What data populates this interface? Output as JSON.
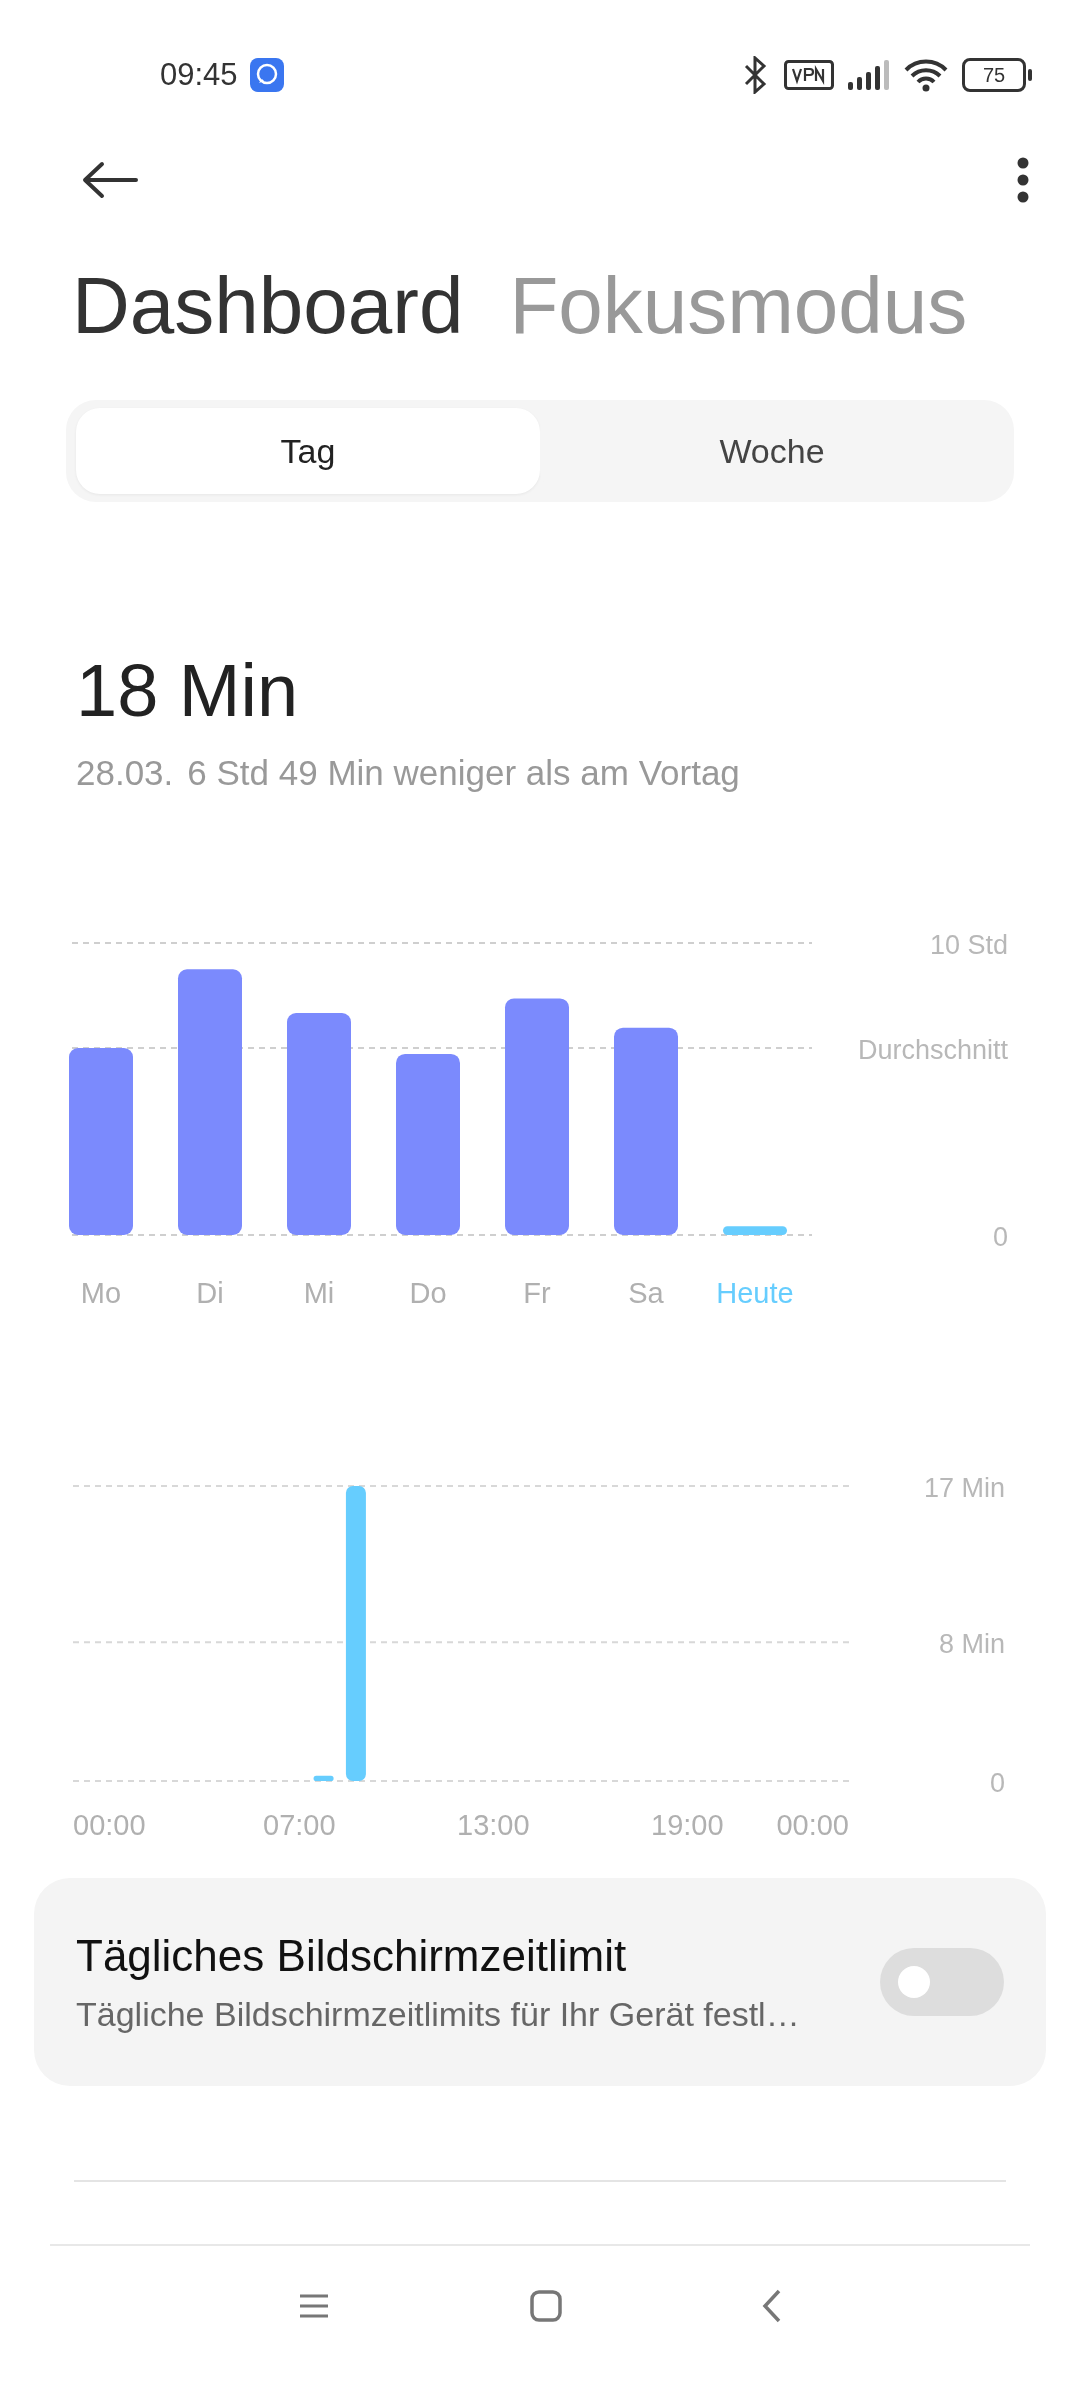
{
  "status_bar": {
    "time": "09:45",
    "battery": "75"
  },
  "title_tabs": [
    {
      "label": "Dashboard",
      "selected": true
    },
    {
      "label": "Fokusmodus",
      "selected": false
    }
  ],
  "segments": [
    {
      "label": "Tag",
      "selected": true
    },
    {
      "label": "Woche",
      "selected": false
    }
  ],
  "summary": {
    "total": "18 Min",
    "date": "28.03.",
    "comparison": "6 Std 49 Min weniger als am Vortag"
  },
  "week_chart": {
    "chart_data": {
      "type": "bar",
      "categories": [
        "Mo",
        "Di",
        "Mi",
        "Do",
        "Fr",
        "Sa",
        "Heute"
      ],
      "ylim": [
        0,
        10
      ],
      "yticks": [
        0,
        {
          "value": 6.4,
          "label": "Durchschnitt"
        },
        {
          "value": 10,
          "label": "10 Std"
        }
      ],
      "series": [
        {
          "color": "#7b8afd",
          "values": [
            6.4,
            9.1,
            7.6,
            6.2,
            8.1,
            7.1,
            null
          ]
        },
        {
          "color": "#66cdfe",
          "values": [
            null,
            null,
            null,
            null,
            null,
            null,
            0.3
          ]
        }
      ]
    }
  },
  "day_chart": {
    "chart_data": {
      "type": "bar",
      "xlim": [
        0,
        24
      ],
      "ylim": [
        0,
        17
      ],
      "x": [
        7.75,
        8.75
      ],
      "xticks": [
        {
          "value": 0,
          "label": "00:00"
        },
        {
          "value": 7,
          "label": "07:00"
        },
        {
          "value": 13,
          "label": "13:00"
        },
        {
          "value": 19,
          "label": "19:00"
        },
        {
          "value": 24,
          "label": "00:00"
        }
      ],
      "yticks": [
        0,
        {
          "value": 8,
          "label": "8 Min"
        },
        {
          "value": 17,
          "label": "17 Min"
        }
      ],
      "series": [
        {
          "color": "#66cdfe",
          "values": [
            0.3,
            17
          ]
        }
      ]
    }
  },
  "limit_card": {
    "title": "Tägliches Bildschirmzeitlimit",
    "subtitle": "Tägliche Bildschirmzeitlimits für Ihr Gerät festl…",
    "on": false
  }
}
